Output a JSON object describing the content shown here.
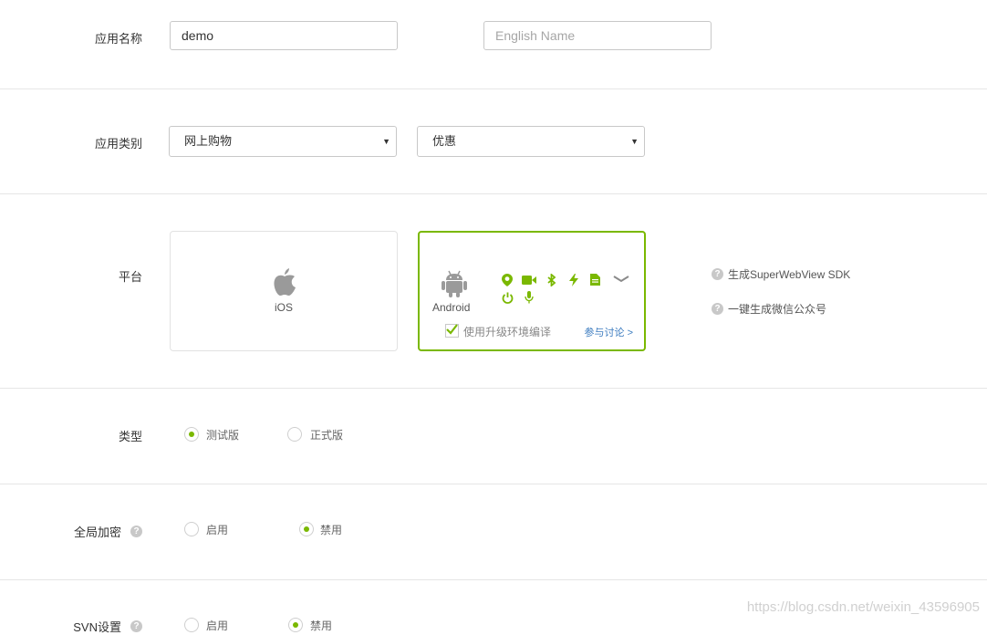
{
  "app_name": {
    "label": "应用名称",
    "value": "demo",
    "english_placeholder": "English Name"
  },
  "app_category": {
    "label": "应用类别",
    "primary_selected": "网上购物",
    "secondary_selected": "优惠"
  },
  "platform": {
    "label": "平台",
    "ios_label": "iOS",
    "android_label": "Android",
    "upgrade_checkbox_label": "使用升级环境编译",
    "upgrade_checked": true,
    "discuss_link": "参与讨论 >",
    "side_links": [
      "生成SuperWebView SDK",
      "一键生成微信公众号"
    ],
    "android_feature_icons": [
      "location-icon",
      "video-icon",
      "bluetooth-icon",
      "flash-icon",
      "document-icon",
      "expand-chevron-icon",
      "power-icon",
      "microphone-icon"
    ]
  },
  "type": {
    "label": "类型",
    "options": [
      "测试版",
      "正式版"
    ],
    "selected": "测试版"
  },
  "global_encryption": {
    "label": "全局加密",
    "options": [
      "启用",
      "禁用"
    ],
    "selected": "禁用"
  },
  "svn": {
    "label": "SVN设置",
    "options": [
      "启用",
      "禁用"
    ],
    "selected": "禁用"
  },
  "watermark": "https://blog.csdn.net/weixin_43596905",
  "colors": {
    "accent_green": "#7ab800",
    "link_blue": "#3b7bbf",
    "border": "#c8c8c8"
  }
}
